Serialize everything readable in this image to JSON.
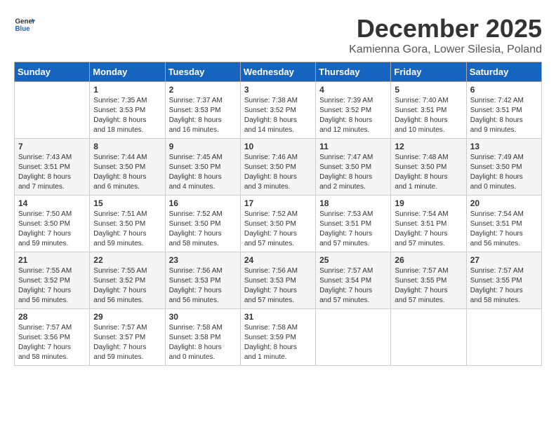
{
  "header": {
    "logo_general": "General",
    "logo_blue": "Blue",
    "month_title": "December 2025",
    "location": "Kamienna Gora, Lower Silesia, Poland"
  },
  "weekdays": [
    "Sunday",
    "Monday",
    "Tuesday",
    "Wednesday",
    "Thursday",
    "Friday",
    "Saturday"
  ],
  "weeks": [
    [
      {
        "day": "",
        "info": ""
      },
      {
        "day": "1",
        "info": "Sunrise: 7:35 AM\nSunset: 3:53 PM\nDaylight: 8 hours\nand 18 minutes."
      },
      {
        "day": "2",
        "info": "Sunrise: 7:37 AM\nSunset: 3:53 PM\nDaylight: 8 hours\nand 16 minutes."
      },
      {
        "day": "3",
        "info": "Sunrise: 7:38 AM\nSunset: 3:52 PM\nDaylight: 8 hours\nand 14 minutes."
      },
      {
        "day": "4",
        "info": "Sunrise: 7:39 AM\nSunset: 3:52 PM\nDaylight: 8 hours\nand 12 minutes."
      },
      {
        "day": "5",
        "info": "Sunrise: 7:40 AM\nSunset: 3:51 PM\nDaylight: 8 hours\nand 10 minutes."
      },
      {
        "day": "6",
        "info": "Sunrise: 7:42 AM\nSunset: 3:51 PM\nDaylight: 8 hours\nand 9 minutes."
      }
    ],
    [
      {
        "day": "7",
        "info": "Sunrise: 7:43 AM\nSunset: 3:51 PM\nDaylight: 8 hours\nand 7 minutes."
      },
      {
        "day": "8",
        "info": "Sunrise: 7:44 AM\nSunset: 3:50 PM\nDaylight: 8 hours\nand 6 minutes."
      },
      {
        "day": "9",
        "info": "Sunrise: 7:45 AM\nSunset: 3:50 PM\nDaylight: 8 hours\nand 4 minutes."
      },
      {
        "day": "10",
        "info": "Sunrise: 7:46 AM\nSunset: 3:50 PM\nDaylight: 8 hours\nand 3 minutes."
      },
      {
        "day": "11",
        "info": "Sunrise: 7:47 AM\nSunset: 3:50 PM\nDaylight: 8 hours\nand 2 minutes."
      },
      {
        "day": "12",
        "info": "Sunrise: 7:48 AM\nSunset: 3:50 PM\nDaylight: 8 hours\nand 1 minute."
      },
      {
        "day": "13",
        "info": "Sunrise: 7:49 AM\nSunset: 3:50 PM\nDaylight: 8 hours\nand 0 minutes."
      }
    ],
    [
      {
        "day": "14",
        "info": "Sunrise: 7:50 AM\nSunset: 3:50 PM\nDaylight: 7 hours\nand 59 minutes."
      },
      {
        "day": "15",
        "info": "Sunrise: 7:51 AM\nSunset: 3:50 PM\nDaylight: 7 hours\nand 59 minutes."
      },
      {
        "day": "16",
        "info": "Sunrise: 7:52 AM\nSunset: 3:50 PM\nDaylight: 7 hours\nand 58 minutes."
      },
      {
        "day": "17",
        "info": "Sunrise: 7:52 AM\nSunset: 3:50 PM\nDaylight: 7 hours\nand 57 minutes."
      },
      {
        "day": "18",
        "info": "Sunrise: 7:53 AM\nSunset: 3:51 PM\nDaylight: 7 hours\nand 57 minutes."
      },
      {
        "day": "19",
        "info": "Sunrise: 7:54 AM\nSunset: 3:51 PM\nDaylight: 7 hours\nand 57 minutes."
      },
      {
        "day": "20",
        "info": "Sunrise: 7:54 AM\nSunset: 3:51 PM\nDaylight: 7 hours\nand 56 minutes."
      }
    ],
    [
      {
        "day": "21",
        "info": "Sunrise: 7:55 AM\nSunset: 3:52 PM\nDaylight: 7 hours\nand 56 minutes."
      },
      {
        "day": "22",
        "info": "Sunrise: 7:55 AM\nSunset: 3:52 PM\nDaylight: 7 hours\nand 56 minutes."
      },
      {
        "day": "23",
        "info": "Sunrise: 7:56 AM\nSunset: 3:53 PM\nDaylight: 7 hours\nand 56 minutes."
      },
      {
        "day": "24",
        "info": "Sunrise: 7:56 AM\nSunset: 3:53 PM\nDaylight: 7 hours\nand 57 minutes."
      },
      {
        "day": "25",
        "info": "Sunrise: 7:57 AM\nSunset: 3:54 PM\nDaylight: 7 hours\nand 57 minutes."
      },
      {
        "day": "26",
        "info": "Sunrise: 7:57 AM\nSunset: 3:55 PM\nDaylight: 7 hours\nand 57 minutes."
      },
      {
        "day": "27",
        "info": "Sunrise: 7:57 AM\nSunset: 3:55 PM\nDaylight: 7 hours\nand 58 minutes."
      }
    ],
    [
      {
        "day": "28",
        "info": "Sunrise: 7:57 AM\nSunset: 3:56 PM\nDaylight: 7 hours\nand 58 minutes."
      },
      {
        "day": "29",
        "info": "Sunrise: 7:57 AM\nSunset: 3:57 PM\nDaylight: 7 hours\nand 59 minutes."
      },
      {
        "day": "30",
        "info": "Sunrise: 7:58 AM\nSunset: 3:58 PM\nDaylight: 8 hours\nand 0 minutes."
      },
      {
        "day": "31",
        "info": "Sunrise: 7:58 AM\nSunset: 3:59 PM\nDaylight: 8 hours\nand 1 minute."
      },
      {
        "day": "",
        "info": ""
      },
      {
        "day": "",
        "info": ""
      },
      {
        "day": "",
        "info": ""
      }
    ]
  ]
}
